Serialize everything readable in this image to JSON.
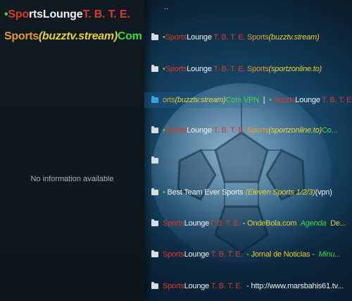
{
  "colors": {
    "green": "#3fd93f",
    "red": "#d83a2a",
    "white": "#f2f2f2",
    "orange": "#e39a2a",
    "yellow": "#e6d230",
    "teal": "#28b7b0",
    "gray": "#c8ced3",
    "folder": "#d7dde2",
    "folder_selected": "#3aa3e6"
  },
  "info_panel": {
    "title_line1": [
      {
        "text": "•",
        "color": "#3fd93f"
      },
      {
        "text": "Spo",
        "color": "#d83a2a"
      },
      {
        "text": "rts",
        "color": "#f2f2f2"
      },
      {
        "text": "Lounge",
        "color": "#f2f2f2"
      },
      {
        "text": "T. B. T. E.",
        "color": "#d83a2a"
      }
    ],
    "title_line2": [
      {
        "text": "Sports",
        "color": "#e39a2a"
      },
      {
        "text": "(buzztv.stream)",
        "color": "#e6d230",
        "italic": true
      },
      {
        "text": "Com",
        "color": "#3fd93f"
      }
    ],
    "no_info_text": "No information available"
  },
  "list": {
    "parent_label": "..",
    "items": [
      {
        "selected": false,
        "segments": [
          {
            "text": "•",
            "color": "#3fd93f"
          },
          {
            "text": "Sports",
            "color": "#d83a2a"
          },
          {
            "text": "Lounge",
            "color": "#f2f2f2"
          },
          {
            "text": " T. B. T. E. ",
            "color": "#d83a2a"
          },
          {
            "text": "Sports",
            "color": "#e39a2a"
          },
          {
            "text": "(buzztv.stream)",
            "color": "#e6d230",
            "italic": true
          }
        ]
      },
      {
        "selected": false,
        "segments": [
          {
            "text": "•",
            "color": "#3fd93f"
          },
          {
            "text": "Sports",
            "color": "#d83a2a"
          },
          {
            "text": "Lounge",
            "color": "#f2f2f2"
          },
          {
            "text": " T. B. T. E. ",
            "color": "#d83a2a"
          },
          {
            "text": "Sports",
            "color": "#e39a2a"
          },
          {
            "text": "(sportzonline.to)",
            "color": "#e6d230",
            "italic": true
          }
        ]
      },
      {
        "selected": true,
        "segments": [
          {
            "text": "orts",
            "color": "#e39a2a"
          },
          {
            "text": "(buzztv.stream)",
            "color": "#e6d230",
            "italic": true
          },
          {
            "text": "Com VPN",
            "color": "#3fd93f"
          },
          {
            "text": "  |  ",
            "color": "#f2f2f2"
          },
          {
            "text": "• ",
            "color": "#3fd93f"
          },
          {
            "text": "Sports",
            "color": "#d83a2a"
          },
          {
            "text": "Lounge",
            "color": "#f2f2f2"
          },
          {
            "text": " T. B. T. E.",
            "color": "#d83a2a"
          }
        ]
      },
      {
        "selected": false,
        "segments": [
          {
            "text": "•",
            "color": "#3fd93f"
          },
          {
            "text": "Sports",
            "color": "#d83a2a"
          },
          {
            "text": "Lounge",
            "color": "#f2f2f2"
          },
          {
            "text": " T. B. T. E. ",
            "color": "#d83a2a"
          },
          {
            "text": "Sports",
            "color": "#e39a2a"
          },
          {
            "text": "(sportzonline.to)",
            "color": "#e6d230",
            "italic": true
          },
          {
            "text": "Co...",
            "color": "#3fd93f"
          }
        ]
      },
      {
        "selected": false,
        "segments": []
      },
      {
        "selected": false,
        "segments": [
          {
            "text": "• ",
            "color": "#3fd93f"
          },
          {
            "text": "Best Team Ever Sports ",
            "color": "#f2f2f2"
          },
          {
            "text": "(Eleven Sports 1/2/3)",
            "color": "#e6d230",
            "italic": true
          },
          {
            "text": "(vpn)",
            "color": "#f2f2f2"
          }
        ]
      },
      {
        "selected": false,
        "segments": [
          {
            "text": "Sports",
            "color": "#d83a2a"
          },
          {
            "text": "Lounge",
            "color": "#f2f2f2"
          },
          {
            "text": "T. B. T. E.",
            "color": "#d83a2a"
          },
          {
            "text": " - ",
            "color": "#f2f2f2"
          },
          {
            "text": "OndeBola.com",
            "color": "#e6d230"
          },
          {
            "text": "  Agenda  ",
            "color": "#3fd93f",
            "italic": true
          },
          {
            "text": "De...",
            "color": "#e6d230"
          }
        ]
      },
      {
        "selected": false,
        "segments": [
          {
            "text": "Sports",
            "color": "#d83a2a"
          },
          {
            "text": "Lounge",
            "color": "#f2f2f2"
          },
          {
            "text": " T. B. T. E. ",
            "color": "#d83a2a"
          },
          {
            "text": " - Jornal de Noticias - ",
            "color": "#e6d230"
          },
          {
            "text": " Minu...",
            "color": "#3fd93f",
            "italic": true
          }
        ]
      },
      {
        "selected": false,
        "segments": [
          {
            "text": "Sports",
            "color": "#d83a2a"
          },
          {
            "text": "Lounge",
            "color": "#f2f2f2"
          },
          {
            "text": " T. B. T. E. ",
            "color": "#d83a2a"
          },
          {
            "text": " - ",
            "color": "#f2f2f2"
          },
          {
            "text": "http://www.marsbahis61.tv...",
            "color": "#f2f2f2"
          }
        ]
      }
    ]
  }
}
